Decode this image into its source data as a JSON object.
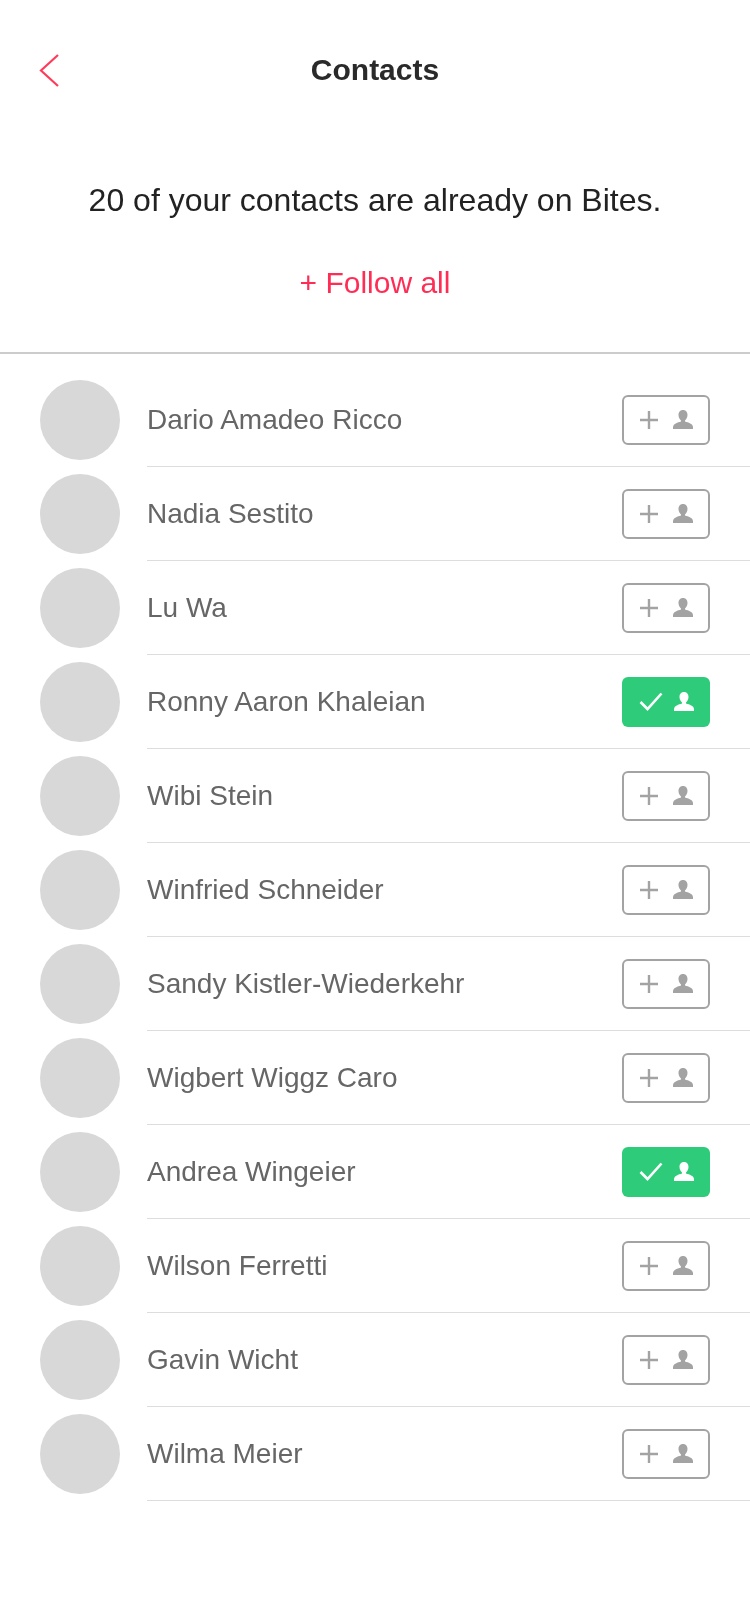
{
  "header": {
    "title": "Contacts"
  },
  "message": "20 of your contacts are already on Bites.",
  "follow_all": {
    "label": "+ Follow all"
  },
  "contacts": [
    {
      "name": "Dario Amadeo Ricco",
      "followed": false
    },
    {
      "name": "Nadia Sestito",
      "followed": false
    },
    {
      "name": "Lu Wa",
      "followed": false
    },
    {
      "name": "Ronny Aaron Khaleian",
      "followed": true
    },
    {
      "name": "Wibi Stein",
      "followed": false
    },
    {
      "name": "Winfried Schneider",
      "followed": false
    },
    {
      "name": "Sandy Kistler-Wiederkehr",
      "followed": false
    },
    {
      "name": "Wigbert Wiggz Caro",
      "followed": false
    },
    {
      "name": "Andrea Wingeier",
      "followed": true
    },
    {
      "name": "Wilson Ferretti",
      "followed": false
    },
    {
      "name": "Gavin Wicht",
      "followed": false
    },
    {
      "name": "Wilma Meier",
      "followed": false
    }
  ]
}
